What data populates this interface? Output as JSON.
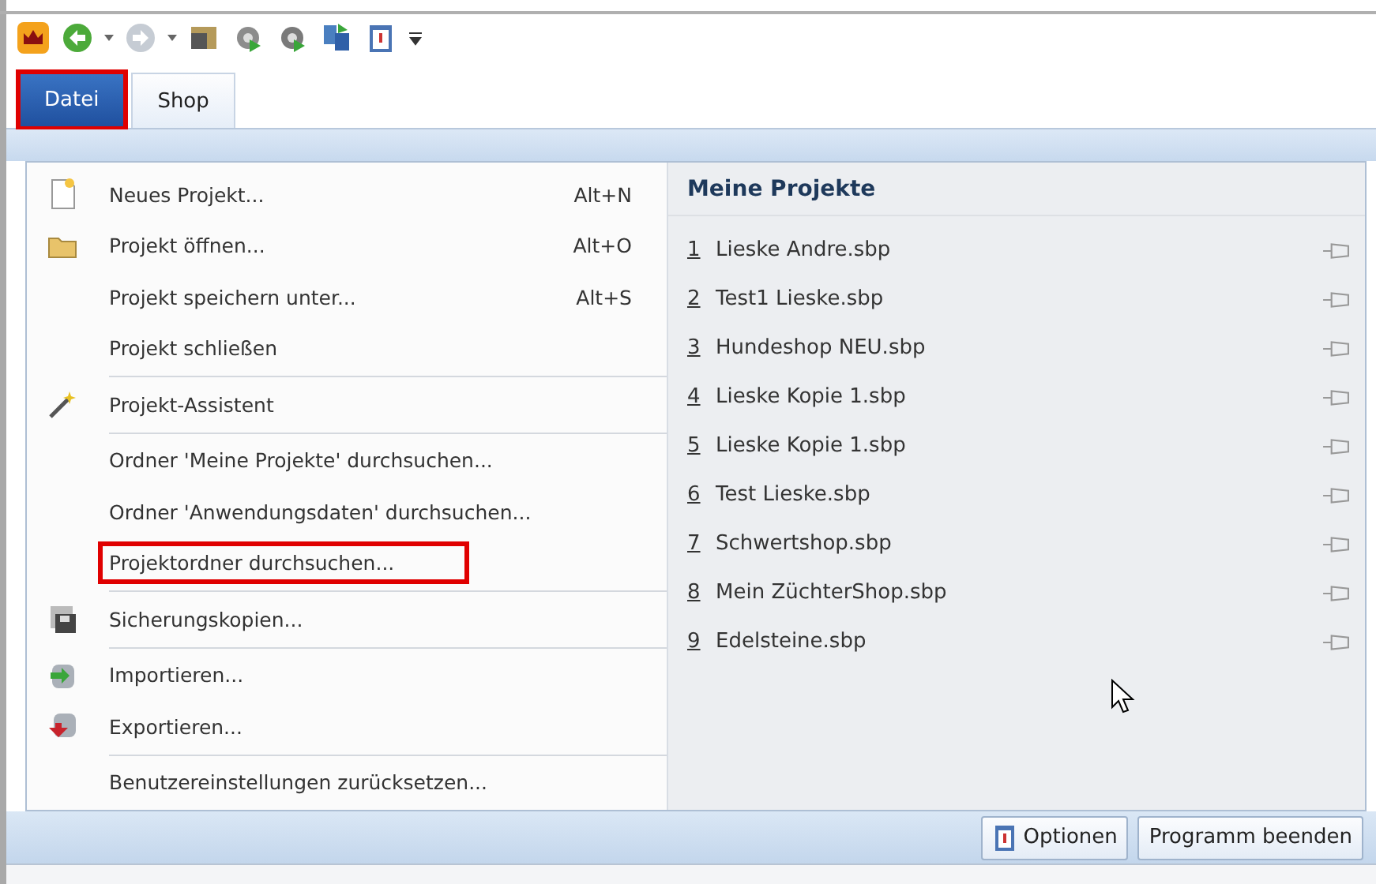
{
  "tabs": [
    {
      "label": "Datei",
      "selected": true,
      "highlighted": true
    },
    {
      "label": "Shop",
      "selected": false,
      "highlighted": false
    }
  ],
  "menu": {
    "groups": [
      [
        {
          "label": "Neues Projekt...",
          "shortcut": "Alt+N",
          "highlighted": false
        },
        {
          "label": "Projekt öffnen...",
          "shortcut": "Alt+O",
          "highlighted": false
        },
        {
          "label": "Projekt speichern unter...",
          "shortcut": "Alt+S",
          "highlighted": false
        },
        {
          "label": "Projekt schließen",
          "highlighted": false
        }
      ],
      [
        {
          "label": "Projekt-Assistent",
          "highlighted": false
        }
      ],
      [
        {
          "label": "Ordner 'Meine Projekte' durchsuchen...",
          "highlighted": false
        },
        {
          "label": "Ordner 'Anwendungsdaten' durchsuchen...",
          "highlighted": false
        },
        {
          "label": "Projektordner durchsuchen...",
          "highlighted": true
        }
      ],
      [
        {
          "label": "Sicherungskopien...",
          "highlighted": false
        }
      ],
      [
        {
          "label": "Importieren...",
          "highlighted": false
        },
        {
          "label": "Exportieren...",
          "highlighted": false
        }
      ],
      [
        {
          "label": "Benutzereinstellungen zurücksetzen...",
          "highlighted": false
        }
      ]
    ]
  },
  "recent": {
    "title": "Meine Projekte",
    "items": [
      {
        "number": "1",
        "name": "Lieske Andre.sbp"
      },
      {
        "number": "2",
        "name": "Test1 Lieske.sbp"
      },
      {
        "number": "3",
        "name": "Hundeshop NEU.sbp"
      },
      {
        "number": "4",
        "name": "Lieske Kopie 1.sbp"
      },
      {
        "number": "5",
        "name": "Lieske Kopie 1.sbp"
      },
      {
        "number": "6",
        "name": "Test Lieske.sbp"
      },
      {
        "number": "7",
        "name": "Schwertshop.sbp"
      },
      {
        "number": "8",
        "name": "Mein ZüchterShop.sbp"
      },
      {
        "number": "9",
        "name": "Edelsteine.sbp"
      }
    ]
  },
  "footer_buttons": [
    {
      "label": "Optionen",
      "kind": "icon"
    },
    {
      "label": "Programm beenden",
      "kind": "plain"
    }
  ]
}
